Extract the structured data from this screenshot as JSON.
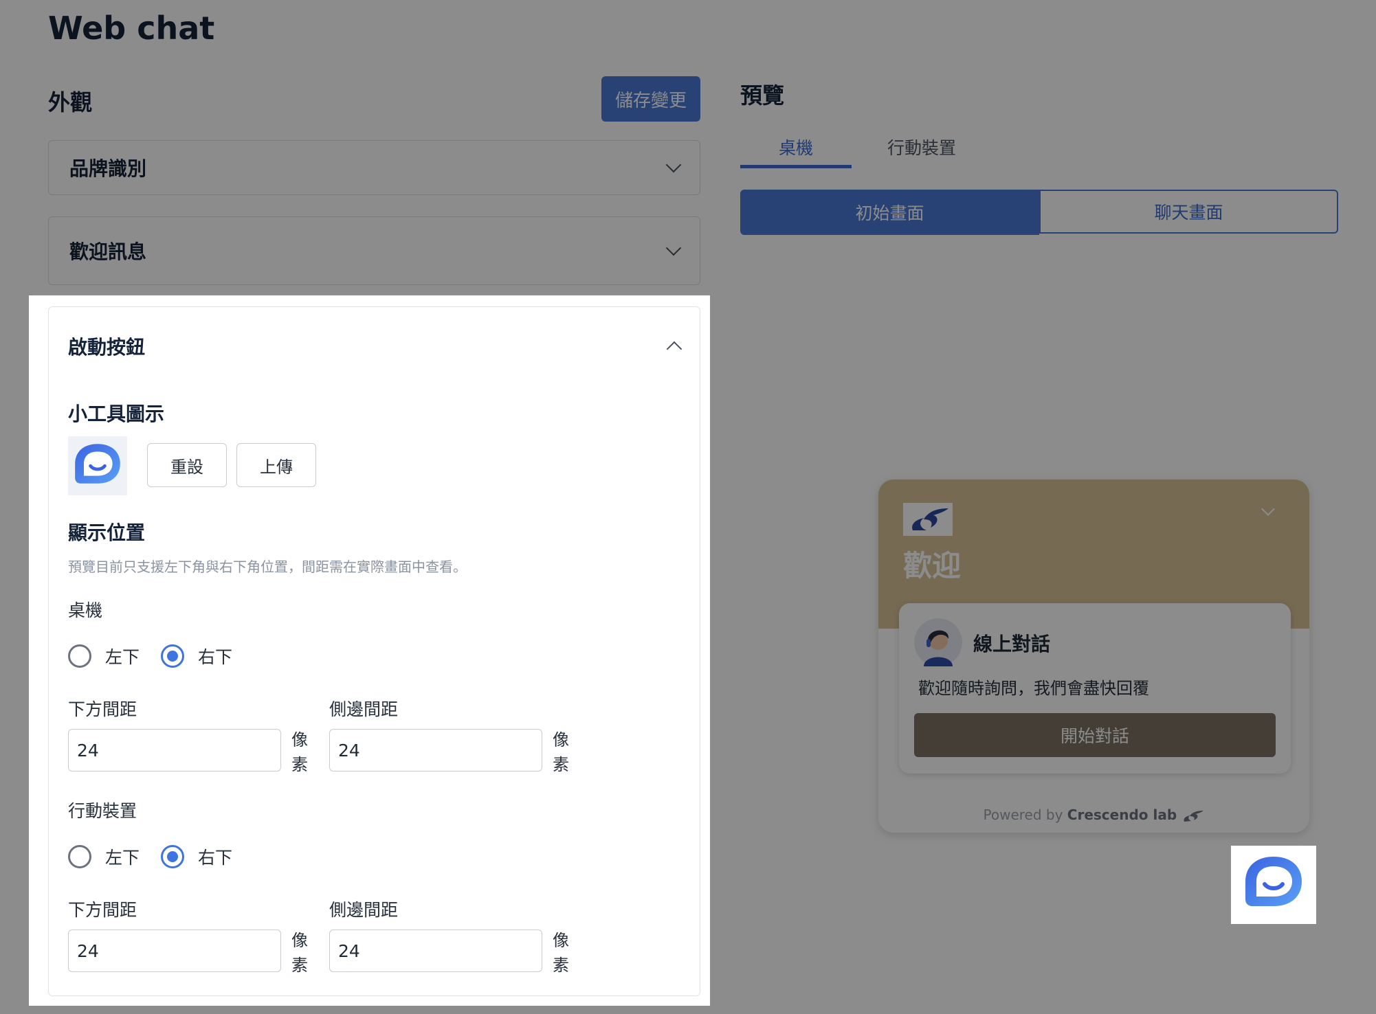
{
  "header": {
    "title": "Web chat"
  },
  "appearance": {
    "title": "外觀",
    "save_label": "儲存變更"
  },
  "accordions": {
    "brand": "品牌識別",
    "welcome": "歡迎訊息",
    "launcher": "啟動按鈕"
  },
  "launcher_panel": {
    "widget_icon_label": "小工具圖示",
    "reset_label": "重設",
    "upload_label": "上傳",
    "position_label": "顯示位置",
    "position_hint": "預覽目前只支援左下角與右下角位置，間距需在實際畫面中查看。",
    "desktop": {
      "label": "桌機",
      "options": [
        "左下",
        "右下"
      ],
      "selected": "右下",
      "bottom_label": "下方間距",
      "bottom_value": "24",
      "side_label": "側邊間距",
      "side_value": "24",
      "unit": "像素"
    },
    "mobile": {
      "label": "行動裝置",
      "options": [
        "左下",
        "右下"
      ],
      "selected": "右下",
      "bottom_label": "下方間距",
      "bottom_value": "24",
      "side_label": "側邊間距",
      "side_value": "24",
      "unit": "像素"
    }
  },
  "preview": {
    "title": "預覽",
    "tabs": [
      "桌機",
      "行動裝置"
    ],
    "active_tab": "桌機",
    "segments": [
      "初始畫面",
      "聊天畫面"
    ],
    "active_segment": "初始畫面",
    "widget": {
      "welcome": "歡迎",
      "card_title": "線上對話",
      "card_text": "歡迎隨時詢問，我們會盡快回覆",
      "start_label": "開始對話",
      "powered_prefix": "Powered by",
      "powered_brand": "Crescendo lab"
    }
  },
  "colors": {
    "accent": "#4a78d6",
    "widget_header": "#d8c197",
    "start_button": "#7d7263",
    "overlay": "rgba(0,0,0,0.45)"
  },
  "icons": {
    "launcher": "chat-bubble-icon",
    "brand_logo": "crescendo-logo-icon",
    "agent": "agent-avatar-icon"
  }
}
